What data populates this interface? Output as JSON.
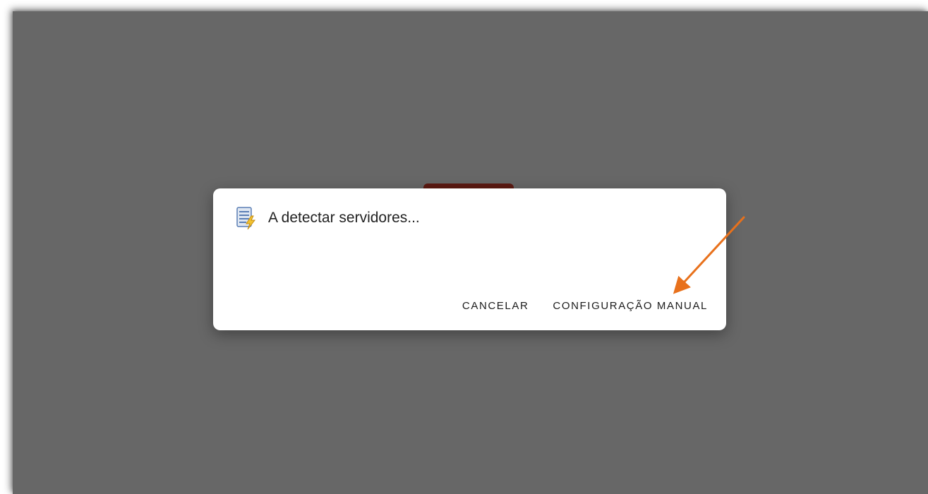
{
  "dialog": {
    "title": "A detectar servidores...",
    "icon": "server-detect-icon",
    "cancel_label": "CANCELAR",
    "manual_config_label": "CONFIGURAÇÃO MANUAL"
  },
  "annotation": {
    "arrow_color": "#e8711c",
    "target": "manual-config-button"
  },
  "colors": {
    "backdrop": "#676767",
    "dialog_bg": "#ffffff",
    "background_button": "#5c1a12"
  }
}
